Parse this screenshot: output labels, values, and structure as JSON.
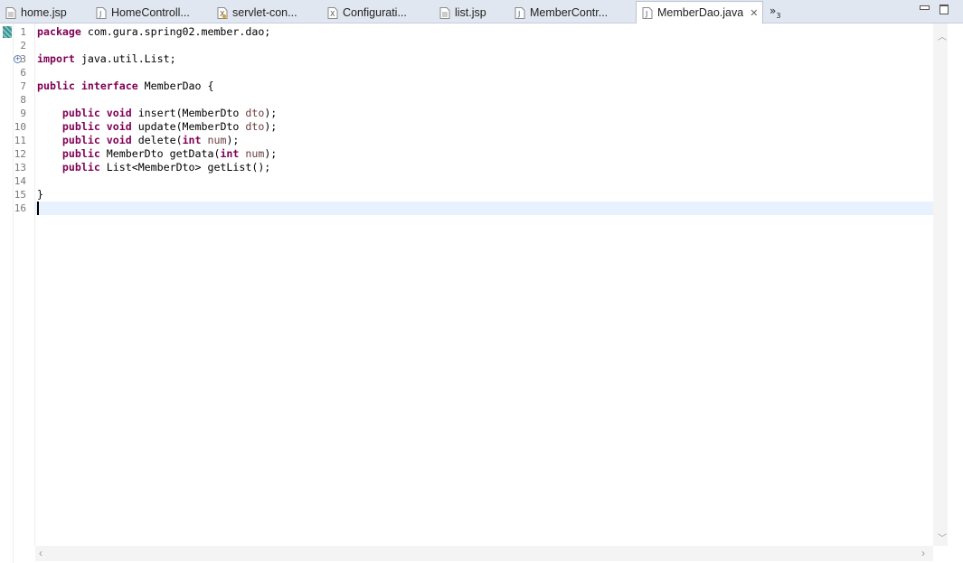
{
  "tabs": [
    {
      "label": "home.jsp",
      "icon": "jsp-file-icon",
      "active": false
    },
    {
      "label": "HomeControll...",
      "icon": "java-file-icon",
      "active": false
    },
    {
      "label": "servlet-con...",
      "icon": "xml-file-icon",
      "active": false
    },
    {
      "label": "Configurati...",
      "icon": "xml-file-icon",
      "active": false
    },
    {
      "label": "list.jsp",
      "icon": "jsp-file-icon",
      "active": false
    },
    {
      "label": "MemberContr...",
      "icon": "java-file-icon",
      "active": false
    },
    {
      "label": "MemberDao.java",
      "icon": "java-file-icon",
      "active": true,
      "close_glyph": "✕"
    }
  ],
  "overflow": {
    "glyph": "»",
    "count": "3"
  },
  "fold": {
    "glyph": "+"
  },
  "editor": {
    "line_numbers": [
      "1",
      "2",
      "3",
      "6",
      "7",
      "8",
      "9",
      "10",
      "11",
      "12",
      "13",
      "14",
      "15",
      "16"
    ],
    "lines": [
      {
        "num": "1",
        "tokens": [
          {
            "t": "package",
            "k": "kw"
          },
          {
            "t": " com.gura.spring02.member.dao;"
          }
        ]
      },
      {
        "num": "2",
        "tokens": []
      },
      {
        "num": "3",
        "tokens": [
          {
            "t": "import",
            "k": "kw"
          },
          {
            "t": " java.util.List;"
          }
        ]
      },
      {
        "num": "6",
        "tokens": []
      },
      {
        "num": "7",
        "tokens": [
          {
            "t": "public",
            "k": "kw"
          },
          {
            "t": " "
          },
          {
            "t": "interface",
            "k": "kw"
          },
          {
            "t": " MemberDao {"
          }
        ]
      },
      {
        "num": "8",
        "tokens": []
      },
      {
        "num": "9",
        "tokens": [
          {
            "t": "    "
          },
          {
            "t": "public",
            "k": "kw"
          },
          {
            "t": " "
          },
          {
            "t": "void",
            "k": "kw"
          },
          {
            "t": " insert(MemberDto "
          },
          {
            "t": "dto",
            "k": "param"
          },
          {
            "t": ");"
          }
        ]
      },
      {
        "num": "10",
        "tokens": [
          {
            "t": "    "
          },
          {
            "t": "public",
            "k": "kw"
          },
          {
            "t": " "
          },
          {
            "t": "void",
            "k": "kw"
          },
          {
            "t": " update(MemberDto "
          },
          {
            "t": "dto",
            "k": "param"
          },
          {
            "t": ");"
          }
        ]
      },
      {
        "num": "11",
        "tokens": [
          {
            "t": "    "
          },
          {
            "t": "public",
            "k": "kw"
          },
          {
            "t": " "
          },
          {
            "t": "void",
            "k": "kw"
          },
          {
            "t": " delete("
          },
          {
            "t": "int",
            "k": "kw"
          },
          {
            "t": " "
          },
          {
            "t": "num",
            "k": "param"
          },
          {
            "t": ");"
          }
        ]
      },
      {
        "num": "12",
        "tokens": [
          {
            "t": "    "
          },
          {
            "t": "public",
            "k": "kw"
          },
          {
            "t": " MemberDto getData("
          },
          {
            "t": "int",
            "k": "kw"
          },
          {
            "t": " "
          },
          {
            "t": "num",
            "k": "param"
          },
          {
            "t": ");"
          }
        ]
      },
      {
        "num": "13",
        "tokens": [
          {
            "t": "    "
          },
          {
            "t": "public",
            "k": "kw"
          },
          {
            "t": " List<MemberDto> getList();"
          }
        ]
      },
      {
        "num": "14",
        "tokens": []
      },
      {
        "num": "15",
        "tokens": [
          {
            "t": "}"
          }
        ]
      },
      {
        "num": "16",
        "tokens": []
      }
    ]
  },
  "colors": {
    "keyword": "#7f0055",
    "parameter": "#6a3e3e",
    "current_line": "#e8f2fe",
    "tab_bar": "#e1e7f0"
  }
}
